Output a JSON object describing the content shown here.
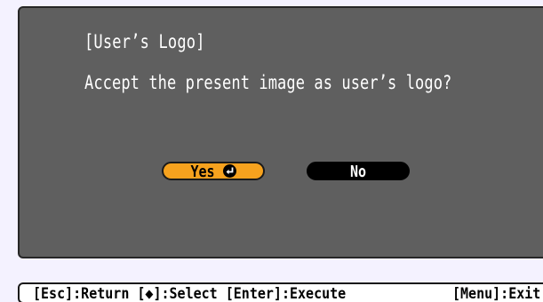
{
  "dialog": {
    "title": "[User’s Logo]",
    "prompt": "Accept the present image as user’s logo?",
    "yes_label": "Yes",
    "no_label": "No",
    "selected": "Yes",
    "accent_color": "#f6a21e",
    "background_color": "#5f5f5f"
  },
  "statusbar": {
    "left_text": "[Esc]:Return [◆]:Select [Enter]:Execute",
    "right_text": "[Menu]:Exit"
  },
  "icons": {
    "enter": "enter-icon"
  }
}
